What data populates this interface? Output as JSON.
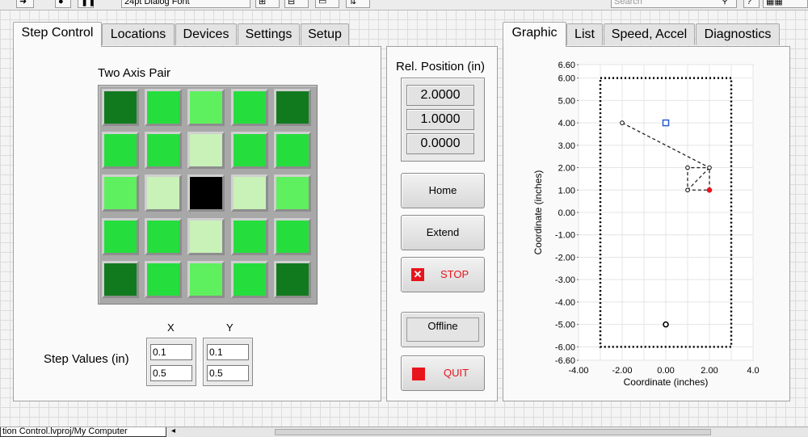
{
  "toolbar": {
    "font_select": "24pt Dialog Font",
    "search_placeholder": "Search"
  },
  "left_tabs": [
    "Step Control",
    "Locations",
    "Devices",
    "Settings",
    "Setup"
  ],
  "right_tabs": [
    "Graphic",
    "List",
    "Speed, Accel",
    "Diagnostics"
  ],
  "step_control": {
    "grid_title": "Two Axis Pair",
    "grid_levels": [
      [
        4,
        2,
        1,
        2,
        4
      ],
      [
        2,
        2,
        0,
        2,
        2
      ],
      [
        1,
        0,
        5,
        0,
        1
      ],
      [
        2,
        2,
        0,
        2,
        2
      ],
      [
        4,
        2,
        1,
        2,
        4
      ]
    ],
    "led_colors": [
      "#c8f2b8",
      "#5ef05e",
      "#25de3e",
      "#1bcc36",
      "#127a1e",
      "#000000"
    ],
    "step_values_label": "Step Values (in)",
    "x_header": "X",
    "y_header": "Y",
    "x_values": [
      "0.1",
      "0.5"
    ],
    "y_values": [
      "0.1",
      "0.5"
    ]
  },
  "rel_position": {
    "title": "Rel. Position (in)",
    "values": [
      "2.0000",
      "1.0000",
      "0.0000"
    ]
  },
  "buttons": {
    "home": "Home",
    "extend": "Extend",
    "stop": "STOP",
    "offline": "Offline",
    "quit": "QUIT"
  },
  "colors": {
    "stop_red": "#e8141c",
    "path": "#222222",
    "current_point": "#e8141c",
    "target_point": "#2a5bd7"
  },
  "status_bar": {
    "project_tab": "tion Control.lvproj/My Computer"
  },
  "chart_data": {
    "type": "scatter",
    "xlabel": "Coordinate (inches)",
    "ylabel": "Coordinate (inches)",
    "xlim": [
      -4.0,
      4.0
    ],
    "ylim": [
      -6.6,
      6.6
    ],
    "x_ticks": [
      "-4.00",
      "-2.00",
      "0.00",
      "2.00",
      "4.0"
    ],
    "y_ticks": [
      "6.60",
      "6.00",
      "5.00",
      "4.00",
      "3.00",
      "2.00",
      "1.00",
      "0.00",
      "-1.00",
      "-2.00",
      "-3.00",
      "-4.00",
      "-5.00",
      "-6.00",
      "-6.60"
    ],
    "y_tick_values": [
      6.6,
      6.0,
      5.0,
      4.0,
      3.0,
      2.0,
      1.0,
      0.0,
      -1.0,
      -2.0,
      -3.0,
      -4.0,
      -5.0,
      -6.0,
      -6.6
    ],
    "x_tick_values": [
      -4,
      -2,
      0,
      2,
      4
    ],
    "grid": true,
    "boundary": {
      "x": [
        -3.0,
        3.0
      ],
      "y": [
        -6.0,
        6.0
      ]
    },
    "path": [
      [
        -2.0,
        4.0
      ],
      [
        2.0,
        2.0
      ],
      [
        1.0,
        2.0
      ],
      [
        1.0,
        1.0
      ],
      [
        2.0,
        1.0
      ],
      [
        2.0,
        2.0
      ],
      [
        1.0,
        1.0
      ]
    ],
    "path_points": [
      [
        -2.0,
        4.0
      ],
      [
        2.0,
        2.0
      ],
      [
        1.0,
        2.0
      ],
      [
        1.0,
        1.0
      ]
    ],
    "current_point": [
      2.0,
      1.0
    ],
    "target_point": [
      0.0,
      4.0
    ],
    "home_point": [
      0.0,
      -5.0
    ]
  }
}
